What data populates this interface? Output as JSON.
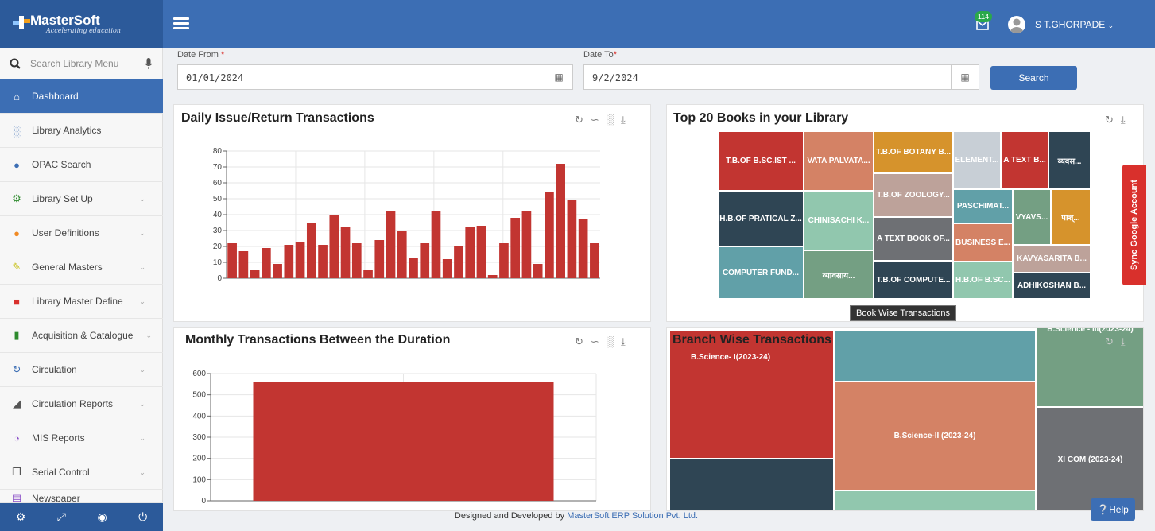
{
  "brand": {
    "name": "MasterSoft",
    "tagline": "Accelerating education"
  },
  "header": {
    "notification_count": "114",
    "user_name": "S T.GHORPADE"
  },
  "sidebar": {
    "search_placeholder": "Search Library Menu",
    "items": [
      {
        "label": "Dashboard",
        "icon": "home-icon"
      },
      {
        "label": "Library Analytics",
        "icon": "bar-chart-icon"
      },
      {
        "label": "OPAC Search",
        "icon": "globe-icon"
      },
      {
        "label": "Library Set Up",
        "icon": "cogs-icon"
      },
      {
        "label": "User Definitions",
        "icon": "users-icon"
      },
      {
        "label": "General Masters",
        "icon": "edit-icon"
      },
      {
        "label": "Library Master Define",
        "icon": "cubes-icon"
      },
      {
        "label": "Acquisition & Catalogue",
        "icon": "book-icon"
      },
      {
        "label": "Circulation",
        "icon": "refresh-icon"
      },
      {
        "label": "Circulation Reports",
        "icon": "area-chart-icon"
      },
      {
        "label": "MIS Reports",
        "icon": "pie-chart-icon"
      },
      {
        "label": "Serial Control",
        "icon": "copy-icon"
      },
      {
        "label": "Newspaper",
        "icon": "newspaper-icon"
      }
    ],
    "footer_icons": [
      "gear-icon",
      "expand-icon",
      "eye-slash-icon",
      "power-icon"
    ]
  },
  "filters": {
    "date_from_label": "Date From",
    "date_from_value": "01/01/2024",
    "date_to_label": "Date To",
    "date_to_value": "9/2/2024",
    "required_mark": "*",
    "search_button": "Search"
  },
  "panels": {
    "daily_title": "Daily Issue/Return Transactions",
    "top_books_title": "Top 20 Books in your Library",
    "monthly_title": "Monthly Transactions Between the Duration",
    "branch_title": "Branch Wise Transactions",
    "tooltip": "Book Wise Transactions"
  },
  "chart_data": [
    {
      "type": "bar",
      "title": "Daily Issue/Return Transactions",
      "ylim": [
        0,
        80
      ],
      "yticks": [
        0,
        10,
        20,
        30,
        40,
        50,
        60,
        70,
        80
      ],
      "values": [
        22,
        17,
        5,
        19,
        9,
        21,
        23,
        35,
        21,
        40,
        32,
        22,
        5,
        24,
        42,
        30,
        13,
        22,
        42,
        12,
        20,
        32,
        33,
        2,
        22,
        38,
        42,
        9,
        54,
        72,
        49,
        37,
        22
      ],
      "color": "#c23531"
    },
    {
      "type": "bar",
      "title": "Monthly Transactions Between the Duration",
      "ylim": [
        0,
        600
      ],
      "yticks": [
        0,
        100,
        200,
        300,
        400,
        500,
        600
      ],
      "values": [
        562
      ],
      "color": "#c23531"
    },
    {
      "type": "heatmap",
      "title": "Top 20 Books in your Library",
      "labels": [
        "T.B.OF B.SC.IST ...",
        "VATA PALVATA...",
        "T.B.OF BOTANY B...",
        "ELEMENT...",
        "A TEXT B...",
        "व्यवस...",
        "H.B.OF PRATICAL Z...",
        "CHINISACHI K...",
        "T.B.OF ZOOLOGY...",
        "PASCHIMAT...",
        "VYAVS...",
        "पाश्...",
        "A TEXT BOOK OF...",
        "BUSINESS E...",
        "KAVYASARITA B...",
        "COMPUTER FUND...",
        "व्यावसाय...",
        "T.B.OF COMPUTE...",
        "H.B.OF B.SC...",
        "ADHIKOSHAN B..."
      ]
    },
    {
      "type": "heatmap",
      "title": "Branch Wise Transactions",
      "labels": [
        "B.Science- I(2023-24)",
        "B.Science-II (2023-24)",
        "XI COM (2023-24)",
        "B.Science - III(2023-24)"
      ]
    }
  ],
  "footer": {
    "text": "Designed and Developed by ",
    "link": "MasterSoft ERP Solution Pvt. Ltd."
  },
  "side_tab": "Sync Google Account",
  "help_button": "Help"
}
